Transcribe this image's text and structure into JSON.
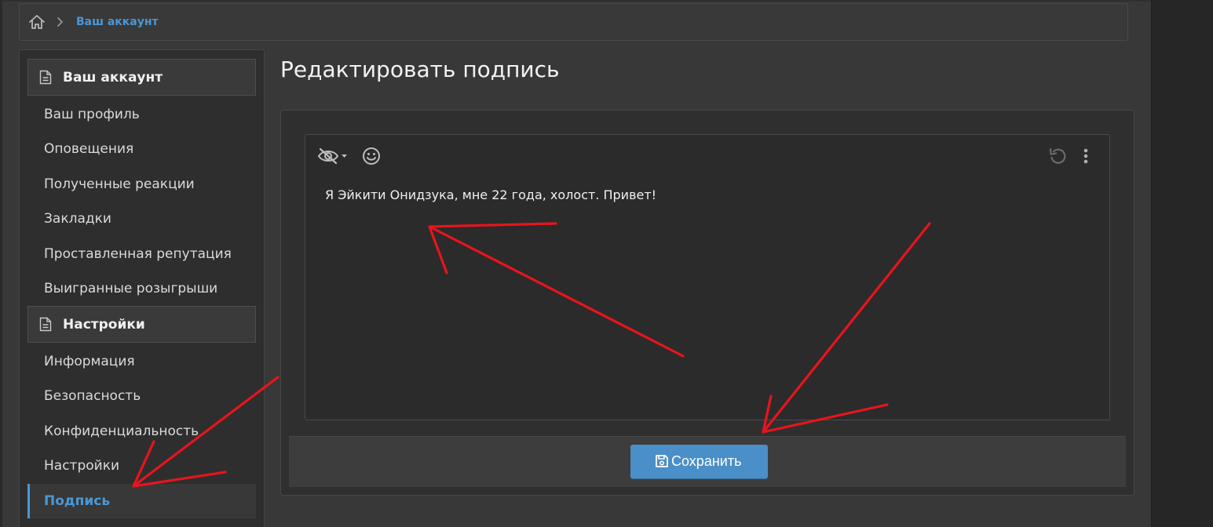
{
  "breadcrumb": {
    "home_icon": "home-icon",
    "separator_icon": "chevron-right-icon",
    "current": "Ваш аккаунт"
  },
  "sidebar": {
    "sections": [
      {
        "header": "Ваш аккаунт",
        "icon": "document-icon",
        "items": [
          {
            "label": "Ваш профиль"
          },
          {
            "label": "Оповещения"
          },
          {
            "label": "Полученные реакции"
          },
          {
            "label": "Закладки"
          },
          {
            "label": "Проставленная репутация"
          },
          {
            "label": "Выигранные розыгрыши"
          }
        ]
      },
      {
        "header": "Настройки",
        "icon": "document-icon",
        "items": [
          {
            "label": "Информация"
          },
          {
            "label": "Безопасность"
          },
          {
            "label": "Конфиденциальность"
          },
          {
            "label": "Настройки"
          },
          {
            "label": "Подпись",
            "active": true
          }
        ]
      }
    ]
  },
  "main": {
    "title": "Редактировать подпись",
    "editor": {
      "toolbar_left": [
        "eye-slash-dropdown-icon",
        "smiley-icon"
      ],
      "toolbar_right": [
        "undo-icon",
        "more-vertical-icon"
      ],
      "content": "Я Эйкити Онидзука, мне 22 года, холост. Привет!"
    },
    "save_label": "Сохранить",
    "save_icon": "floppy-disk-icon"
  },
  "colors": {
    "accent": "#4a97d6",
    "button": "#4a8fc7",
    "annotation": "#e8141c"
  }
}
